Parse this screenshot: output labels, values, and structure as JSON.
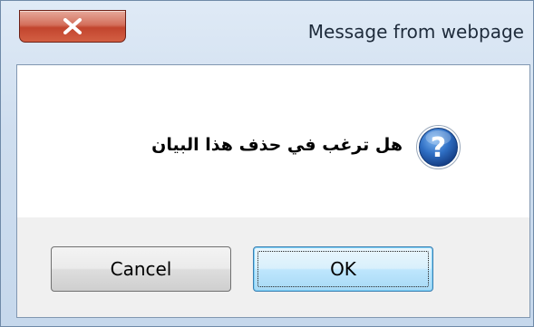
{
  "window": {
    "title": "Message from webpage",
    "close_icon": "close-icon"
  },
  "dialog": {
    "message": "هل ترغب في حذف هذا البيان",
    "icon": "question-icon",
    "buttons": {
      "ok_label": "OK",
      "cancel_label": "Cancel"
    }
  },
  "colors": {
    "close_button": "#c2452e",
    "frame": "#cfdeef",
    "ok_button_border": "#3c7fb1",
    "icon_blue": "#1f5fb3"
  }
}
